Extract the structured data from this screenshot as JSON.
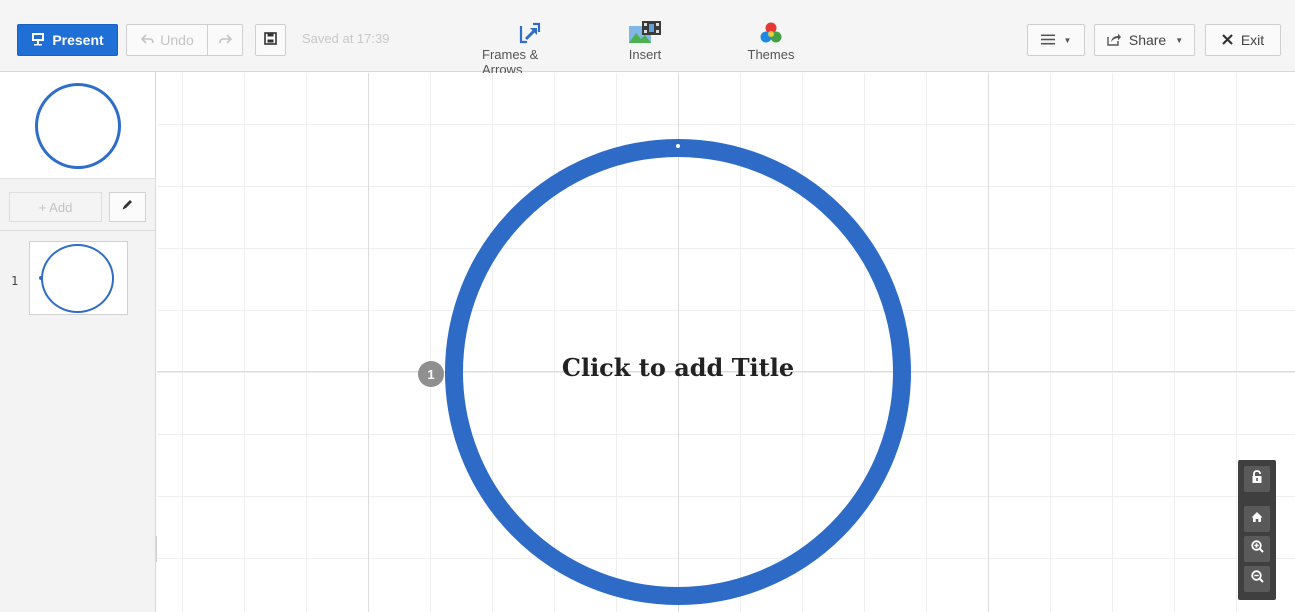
{
  "toolbar": {
    "present_label": "Present",
    "undo_label": "Undo",
    "saved_text": "Saved at 17:39",
    "frames_label": "Frames & Arrows",
    "insert_label": "Insert",
    "themes_label": "Themes",
    "share_label": "Share",
    "exit_label": "Exit"
  },
  "sidebar": {
    "add_label": "+ Add",
    "slides": [
      {
        "number": "1"
      }
    ]
  },
  "canvas": {
    "title_placeholder": "Click to add Title",
    "path_badge": "1"
  },
  "colors": {
    "accent": "#1f6fd6",
    "frame_ring": "#2d6bc7",
    "zoom_panel": "#3f3f3f"
  }
}
